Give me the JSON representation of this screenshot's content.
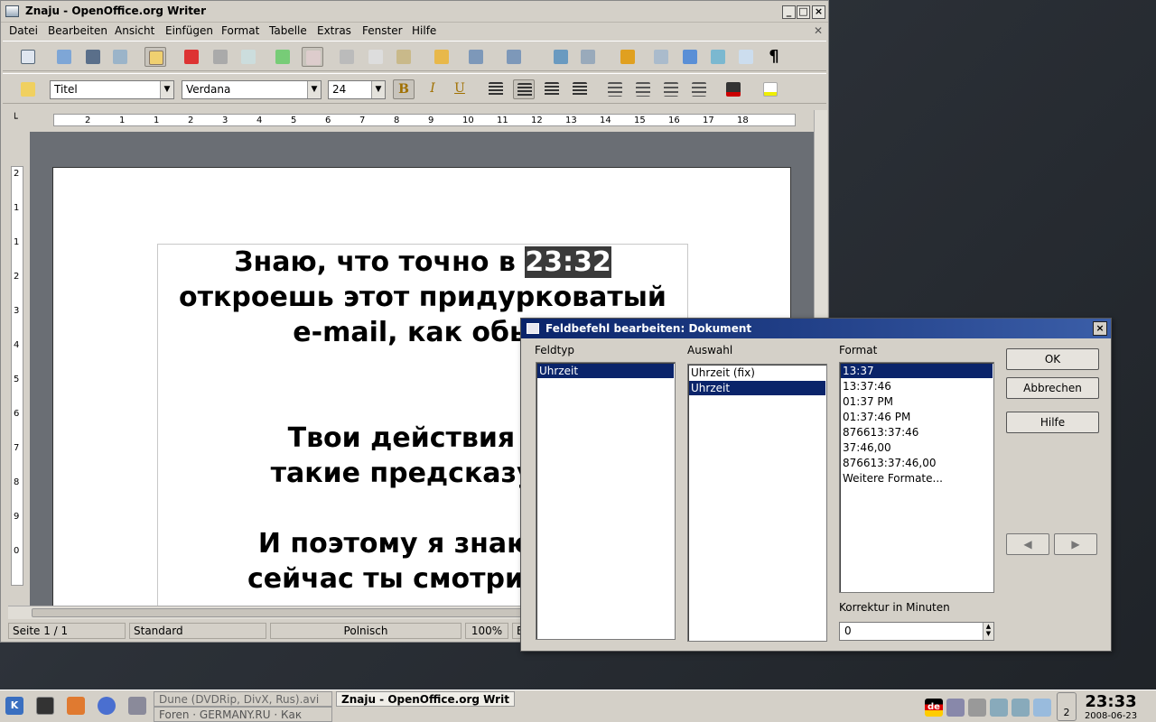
{
  "window": {
    "title": "Znaju - OpenOffice.org Writer",
    "controls": [
      "_",
      "□",
      "×"
    ]
  },
  "menu": [
    "Datei",
    "Bearbeiten",
    "Ansicht",
    "Einfügen",
    "Format",
    "Tabelle",
    "Extras",
    "Fenster",
    "Hilfe"
  ],
  "toolbar": {
    "style_value": "Titel",
    "font_value": "Verdana",
    "size_value": "24",
    "bold": "B",
    "italic": "I",
    "underline": "U"
  },
  "ruler": {
    "h_ticks": [
      "2",
      "1",
      "1",
      "2",
      "3",
      "4",
      "5",
      "6",
      "7",
      "8",
      "9",
      "10",
      "11",
      "12",
      "13",
      "14",
      "15",
      "16",
      "17",
      "18"
    ],
    "v_ticks": [
      "2",
      "1",
      "1",
      "2",
      "3",
      "4",
      "5",
      "6",
      "7",
      "8",
      "9",
      "0"
    ]
  },
  "document": {
    "lines": [
      {
        "pre": "Знаю, что точно в ",
        "hl": "23:32",
        "post": ""
      },
      {
        "pre": "откроешь этот придурковатый",
        "hl": "",
        "post": ""
      },
      {
        "pre": "e-mail, как обыч",
        "hl": "",
        "post": ""
      },
      {
        "pre": "",
        "hl": "",
        "post": ""
      },
      {
        "pre": "",
        "hl": "",
        "post": ""
      },
      {
        "pre": "Твои действия вс",
        "hl": "",
        "post": ""
      },
      {
        "pre": "такие предсказуем",
        "hl": "",
        "post": ""
      },
      {
        "pre": "",
        "hl": "",
        "post": ""
      },
      {
        "pre": "И поэтому я знаю, чт",
        "hl": "",
        "post": ""
      },
      {
        "pre": "сейчас ты смотришь н",
        "hl": "",
        "post": ""
      }
    ]
  },
  "statusbar": {
    "page": "Seite 1 / 1",
    "style": "Standard",
    "language": "Polnisch",
    "zoom": "100%",
    "mode": "E"
  },
  "dialog": {
    "title": "Feldbefehl bearbeiten: Dokument",
    "close": "×",
    "feldtyp_label": "Feldtyp",
    "auswahl_label": "Auswahl",
    "format_label": "Format",
    "feldtyp_items": [
      "Uhrzeit"
    ],
    "auswahl_items": [
      "Uhrzeit (fix)",
      "Uhrzeit"
    ],
    "format_items": [
      "13:37",
      "13:37:46",
      "01:37 PM",
      "01:37:46 PM",
      "876613:37:46",
      "37:46,00",
      "876613:37:46,00",
      "Weitere Formate..."
    ],
    "selected": {
      "feldtyp": 0,
      "auswahl": 1,
      "format": 0
    },
    "korrektur_label": "Korrektur in Minuten",
    "korrektur_value": "0",
    "ok": "OK",
    "cancel": "Abbrechen",
    "help": "Hilfe",
    "prev": "◀",
    "next": "▶"
  },
  "taskbar": {
    "tasks": [
      {
        "label": "Dune (DVDRip, DivX, Rus).avi",
        "active": false
      },
      {
        "label": "Znaju - OpenOffice.org Writ",
        "active": true
      },
      {
        "label": "Foren · GERMANY.RU · Как",
        "active": false
      }
    ],
    "kb_layout": "de",
    "desktop_number": "2",
    "clock": "23:33",
    "date": "2008-06-23"
  }
}
